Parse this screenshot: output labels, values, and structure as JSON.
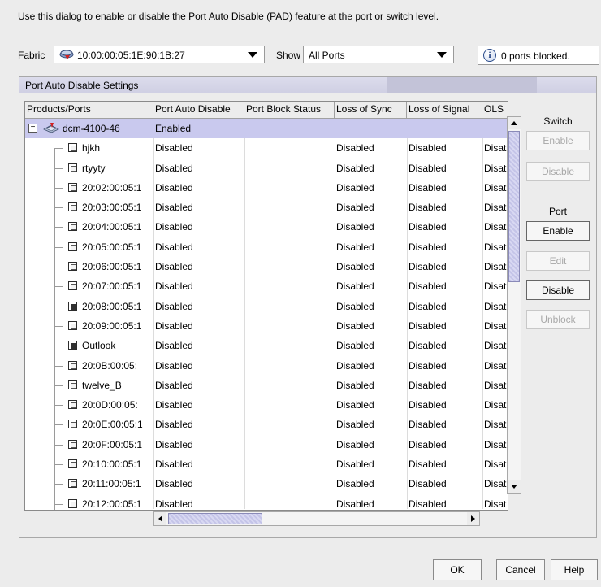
{
  "intro_text": "Use this dialog to enable or disable the Port Auto Disable (PAD) feature at the port or switch level.",
  "fabric": {
    "label": "Fabric",
    "value": "10:00:00:05:1E:90:1B:27"
  },
  "show": {
    "label": "Show",
    "value": "All Ports"
  },
  "status": {
    "text": "0 ports blocked."
  },
  "panel": {
    "title": "Port Auto Disable Settings"
  },
  "table": {
    "columns": [
      "Products/Ports",
      "Port Auto Disable",
      "Port Block Status",
      "Loss of Sync",
      "Loss of Signal",
      "OLS"
    ],
    "switch_row": {
      "name": "dcm-4100-46",
      "pad": "Enabled",
      "expander": "−"
    },
    "rows": [
      {
        "name": "hjkh",
        "pad": "Disabled",
        "block": "",
        "sync": "Disabled",
        "signal": "Disabled",
        "ols": "Disat"
      },
      {
        "name": "rtyyty",
        "pad": "Disabled",
        "block": "",
        "sync": "Disabled",
        "signal": "Disabled",
        "ols": "Disat"
      },
      {
        "name": "20:02:00:05:1",
        "pad": "Disabled",
        "block": "",
        "sync": "Disabled",
        "signal": "Disabled",
        "ols": "Disat"
      },
      {
        "name": "20:03:00:05:1",
        "pad": "Disabled",
        "block": "",
        "sync": "Disabled",
        "signal": "Disabled",
        "ols": "Disat"
      },
      {
        "name": "20:04:00:05:1",
        "pad": "Disabled",
        "block": "",
        "sync": "Disabled",
        "signal": "Disabled",
        "ols": "Disat"
      },
      {
        "name": "20:05:00:05:1",
        "pad": "Disabled",
        "block": "",
        "sync": "Disabled",
        "signal": "Disabled",
        "ols": "Disat"
      },
      {
        "name": "20:06:00:05:1",
        "pad": "Disabled",
        "block": "",
        "sync": "Disabled",
        "signal": "Disabled",
        "ols": "Disat"
      },
      {
        "name": "20:07:00:05:1",
        "pad": "Disabled",
        "block": "",
        "sync": "Disabled",
        "signal": "Disabled",
        "ols": "Disat"
      },
      {
        "name": "20:08:00:05:1",
        "pad": "Disabled",
        "block": "",
        "sync": "Disabled",
        "signal": "Disabled",
        "ols": "Disat"
      },
      {
        "name": "20:09:00:05:1",
        "pad": "Disabled",
        "block": "",
        "sync": "Disabled",
        "signal": "Disabled",
        "ols": "Disat"
      },
      {
        "name": "Outlook",
        "pad": "Disabled",
        "block": "",
        "sync": "Disabled",
        "signal": "Disabled",
        "ols": "Disat"
      },
      {
        "name": "20:0B:00:05:",
        "pad": "Disabled",
        "block": "",
        "sync": "Disabled",
        "signal": "Disabled",
        "ols": "Disat"
      },
      {
        "name": "twelve_B",
        "pad": "Disabled",
        "block": "",
        "sync": "Disabled",
        "signal": "Disabled",
        "ols": "Disat"
      },
      {
        "name": "20:0D:00:05:",
        "pad": "Disabled",
        "block": "",
        "sync": "Disabled",
        "signal": "Disabled",
        "ols": "Disat"
      },
      {
        "name": "20:0E:00:05:1",
        "pad": "Disabled",
        "block": "",
        "sync": "Disabled",
        "signal": "Disabled",
        "ols": "Disat"
      },
      {
        "name": "20:0F:00:05:1",
        "pad": "Disabled",
        "block": "",
        "sync": "Disabled",
        "signal": "Disabled",
        "ols": "Disat"
      },
      {
        "name": "20:10:00:05:1",
        "pad": "Disabled",
        "block": "",
        "sync": "Disabled",
        "signal": "Disabled",
        "ols": "Disat"
      },
      {
        "name": "20:11:00:05:1",
        "pad": "Disabled",
        "block": "",
        "sync": "Disabled",
        "signal": "Disabled",
        "ols": "Disat"
      },
      {
        "name": "20:12:00:05:1",
        "pad": "Disabled",
        "block": "",
        "sync": "Disabled",
        "signal": "Disabled",
        "ols": "Disat"
      }
    ]
  },
  "side": {
    "switch_group": "Switch",
    "switch_enable": "Enable",
    "switch_disable": "Disable",
    "port_group": "Port",
    "port_enable": "Enable",
    "port_edit": "Edit",
    "port_disable": "Disable",
    "port_unblock": "Unblock"
  },
  "footer": {
    "ok": "OK",
    "cancel": "Cancel",
    "help": "Help"
  },
  "colors": {
    "selected_row": "#c9c9ee",
    "panel_title": "#d4d4e6",
    "scroll_thumb": "#c4c4e8"
  }
}
